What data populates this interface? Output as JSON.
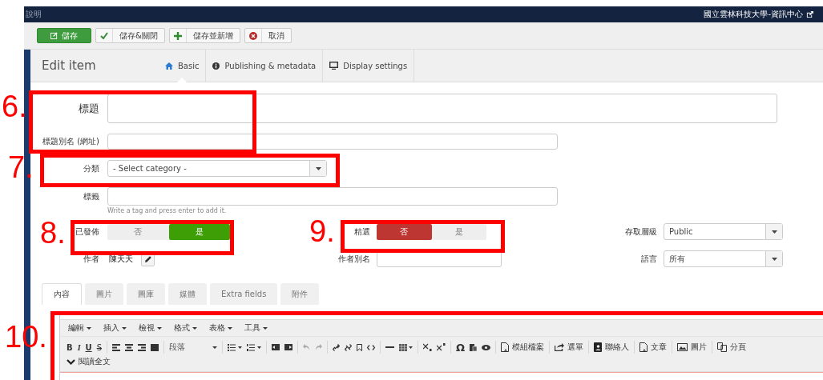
{
  "navbar": {
    "help": "說明",
    "site": "國立雲林科技大學-資訊中心"
  },
  "toolbar": {
    "buttons": [
      {
        "kind": "primary",
        "label": "儲存"
      },
      {
        "kind": "check",
        "label": "儲存&關閉"
      },
      {
        "kind": "plus",
        "label": "儲存並新增"
      },
      {
        "kind": "cancel",
        "label": "取消"
      }
    ]
  },
  "header": {
    "title": "Edit item",
    "tabs": [
      {
        "label": "Basic",
        "selected": true
      },
      {
        "label": "Publishing & metadata",
        "selected": false
      },
      {
        "label": "Display settings",
        "selected": false
      }
    ]
  },
  "form": {
    "title_label": "標題",
    "alias_label": "標題別名 (網址)",
    "category_label": "分類",
    "category_value": "- Select category -",
    "tags_label": "標籤",
    "tags_hint": "Write a tag and press enter to add it.",
    "published": {
      "label": "已發佈",
      "options": [
        {
          "label": "否",
          "selected": false
        },
        {
          "label": "是",
          "selected": true
        }
      ]
    },
    "featured": {
      "label": "精選",
      "options": [
        {
          "label": "否",
          "selected": true
        },
        {
          "label": "是",
          "selected": false
        }
      ]
    },
    "access": {
      "label": "存取層級",
      "value": "Public"
    },
    "author": {
      "label": "作者",
      "value": "陳天天"
    },
    "author_alias_label": "作者別名",
    "language": {
      "label": "語言",
      "value": "所有"
    }
  },
  "content_tabs": [
    {
      "label": "內容",
      "selected": true
    },
    {
      "label": "圖片",
      "selected": false
    },
    {
      "label": "圖庫",
      "selected": false
    },
    {
      "label": "媒體",
      "selected": false
    },
    {
      "label": "Extra fields",
      "selected": false
    },
    {
      "label": "附件",
      "selected": false
    }
  ],
  "editor": {
    "menus": [
      "編輯",
      "插入",
      "檢視",
      "格式",
      "表格",
      "工具"
    ],
    "format_buttons": [
      "B",
      "I",
      "U",
      "S"
    ],
    "paragraph": "段落",
    "symbol": "Ω",
    "plugin_buttons": [
      "模組檔案",
      "選單",
      "聯絡人",
      "文章",
      "圖片",
      "分頁"
    ],
    "readmore": "閱讀全文"
  },
  "annotations": [
    {
      "label": "6."
    },
    {
      "label": "7."
    },
    {
      "label": "8."
    },
    {
      "label": "9."
    },
    {
      "label": "10."
    }
  ]
}
